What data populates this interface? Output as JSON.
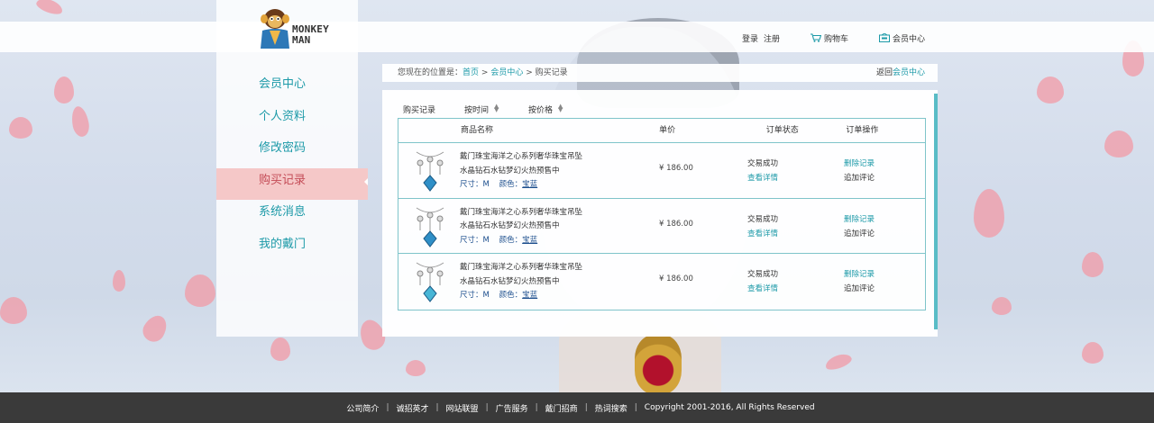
{
  "brand": {
    "logo_line1": "MONKEY",
    "logo_line2": "MAN"
  },
  "header": {
    "login": "登录",
    "register": "注册",
    "cart": "购物车",
    "member_center": "会员中心"
  },
  "sidebar": {
    "items": [
      {
        "label": "会员中心"
      },
      {
        "label": "个人资料"
      },
      {
        "label": "修改密码"
      },
      {
        "label": "购买记录",
        "active": true
      },
      {
        "label": "系统消息"
      },
      {
        "label": "我的戴门"
      }
    ]
  },
  "breadcrumb": {
    "prefix": "您现在的位置是：",
    "home": "首页",
    "sep": ">",
    "member": "会员中心",
    "current": "购买记录",
    "back_prefix": "返回",
    "back_link": "会员中心"
  },
  "filters": {
    "title": "购买记录",
    "by_time": "按时间",
    "by_price": "按价格"
  },
  "table": {
    "headers": {
      "name": "商品名称",
      "price": "单价",
      "status": "订单状态",
      "ops": "订单操作"
    },
    "rows": [
      {
        "title": "戴门珠宝海洋之心系列奢华珠宝吊坠",
        "subtitle": "水晶钻石水钻梦幻火热预售中",
        "size_label": "尺寸：M",
        "color_label": "颜色：",
        "color_value": "宝蓝",
        "price": "¥ 186.00",
        "status": "交易成功",
        "detail": "查看详情",
        "delete": "删除记录",
        "review": "追加评论"
      },
      {
        "title": "戴门珠宝海洋之心系列奢华珠宝吊坠",
        "subtitle": "水晶钻石水钻梦幻火热预售中",
        "size_label": "尺寸：M",
        "color_label": "颜色：",
        "color_value": "宝蓝",
        "price": "¥ 186.00",
        "status": "交易成功",
        "detail": "查看详情",
        "delete": "删除记录",
        "review": "追加评论"
      },
      {
        "title": "戴门珠宝海洋之心系列奢华珠宝吊坠",
        "subtitle": "水晶钻石水钻梦幻火热预售中",
        "size_label": "尺寸：M",
        "color_label": "颜色：",
        "color_value": "宝蓝",
        "price": "¥ 186.00",
        "status": "交易成功",
        "detail": "查看详情",
        "delete": "删除记录",
        "review": "追加评论"
      }
    ]
  },
  "footer": {
    "links": [
      "公司简介",
      "诚招英才",
      "网站联盟",
      "广告服务",
      "戴门招商",
      "热词搜索"
    ],
    "copyright": "Copyright   2001-2016, All Rights Reserved"
  },
  "colors": {
    "accent": "#1d9aa8",
    "active_bg": "#f5c8c8",
    "footer_bg": "#3a3a3a"
  }
}
